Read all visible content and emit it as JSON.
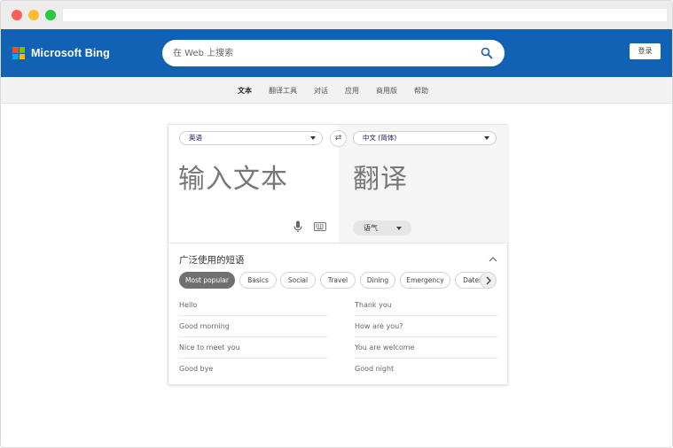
{
  "header": {
    "brand": "Microsoft Bing",
    "search_placeholder": "在 Web 上搜索",
    "login_label": "登录"
  },
  "subnav": {
    "items": [
      "文本",
      "翻译工具",
      "对话",
      "应用",
      "商用版",
      "帮助"
    ],
    "active_index": 0
  },
  "translator": {
    "source_language": "英语",
    "target_language": "中文 (简体)",
    "source_placeholder": "输入文本",
    "target_placeholder": "翻译",
    "tone_label": "语气"
  },
  "phrases": {
    "title": "广泛使用的短语",
    "categories": [
      "Most popular",
      "Basics",
      "Social",
      "Travel",
      "Dining",
      "Emergency",
      "Dates"
    ],
    "active_category_index": 0,
    "left": [
      "Hello",
      "Good morning",
      "Nice to meet you",
      "Good bye"
    ],
    "right": [
      "Thank you",
      "How are you?",
      "You are welcome",
      "Good night"
    ]
  },
  "colors": {
    "header_bg": "#1162b5",
    "active_chip": "#707070"
  },
  "icons": [
    "search-icon",
    "swap-icon",
    "microphone-icon",
    "keyboard-icon",
    "chevron-up-icon",
    "chevron-right-icon"
  ]
}
